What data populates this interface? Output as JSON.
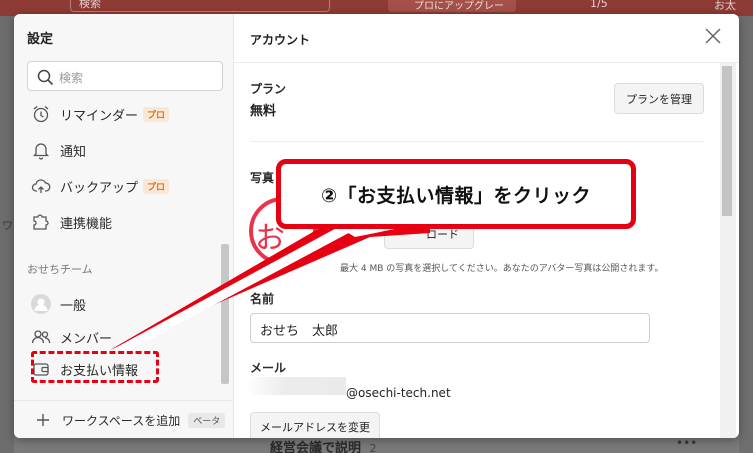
{
  "background": {
    "search_placeholder": "検索",
    "upgrade_label": "プロにアップグレード",
    "counter": "1/5",
    "avatar_text": "お太",
    "bottom_text": "経営会議で説明",
    "bottom_count": "2",
    "left_letter": "ワ"
  },
  "settings": {
    "title": "設定",
    "search_placeholder": "検索",
    "items": [
      {
        "label": "リマインダー",
        "badge": "プロ",
        "icon": "alarm-clock-icon"
      },
      {
        "label": "通知",
        "icon": "bell-icon"
      },
      {
        "label": "バックアップ",
        "badge": "プロ",
        "icon": "cloud-upload-icon"
      },
      {
        "label": "連携機能",
        "icon": "puzzle-icon"
      }
    ],
    "section_label": "おせちチーム",
    "team_items": [
      {
        "label": "一般",
        "icon": "team-avatar-icon"
      },
      {
        "label": "メンバー",
        "icon": "members-icon"
      },
      {
        "label": "お支払い情報",
        "icon": "wallet-icon"
      }
    ],
    "footer": {
      "label": "ワークスペースを追加",
      "badge": "ベータ"
    }
  },
  "account": {
    "title": "アカウント",
    "plan_label": "プラン",
    "plan_value": "無料",
    "manage_plan_button": "プランを管理",
    "photo_label": "写真",
    "avatar_text": "お太",
    "upload_button": "ロード",
    "photo_hint": "最大 4 MB の写真を選択してください。あなたのアバター写真は公開されます。",
    "name_label": "名前",
    "name_value": "おせち　太郎",
    "email_label": "メール",
    "email_value": "@osechi-tech.net",
    "change_email_button": "メールアドレスを変更"
  },
  "annotation": {
    "callout_text": "②「お支払い情報」をクリック",
    "color": "#e60012"
  },
  "colors": {
    "accent_red": "#e60012",
    "pro_badge_bg": "#fbe7d6",
    "pro_badge_text": "#d2741f",
    "avatar_red": "#e8334a"
  }
}
